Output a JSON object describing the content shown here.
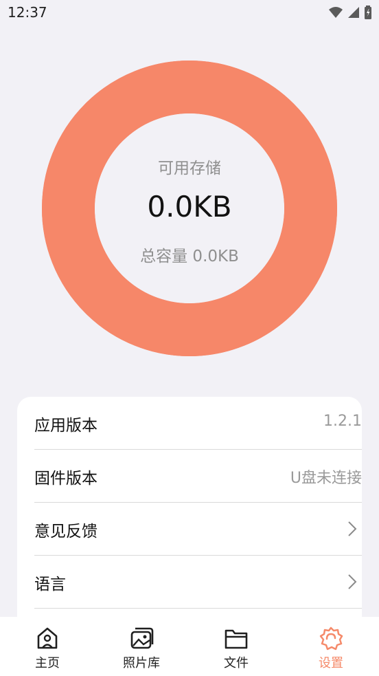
{
  "status": {
    "time": "12:37"
  },
  "storage": {
    "label": "可用存储",
    "value": "0.0KB",
    "total": "总容量 0.0KB",
    "used_fraction": 1,
    "ring_color": "#f68769",
    "inner_color": "#f2f1f6"
  },
  "settings": {
    "rows": [
      {
        "label": "应用版本",
        "value": "1.2.1"
      },
      {
        "label": "固件版本",
        "value": "U盘未连接"
      },
      {
        "label": "意见反馈",
        "icon": "chevron-right-icon"
      },
      {
        "label": "语言",
        "icon": "chevron-right-icon"
      }
    ]
  },
  "nav": {
    "items": [
      {
        "label": "主页",
        "icon": "home-icon"
      },
      {
        "label": "照片库",
        "icon": "photo-library-icon"
      },
      {
        "label": "文件",
        "icon": "folder-icon"
      },
      {
        "label": "设置",
        "icon": "settings-gear-icon"
      }
    ],
    "active_color": "#f58a6a"
  }
}
